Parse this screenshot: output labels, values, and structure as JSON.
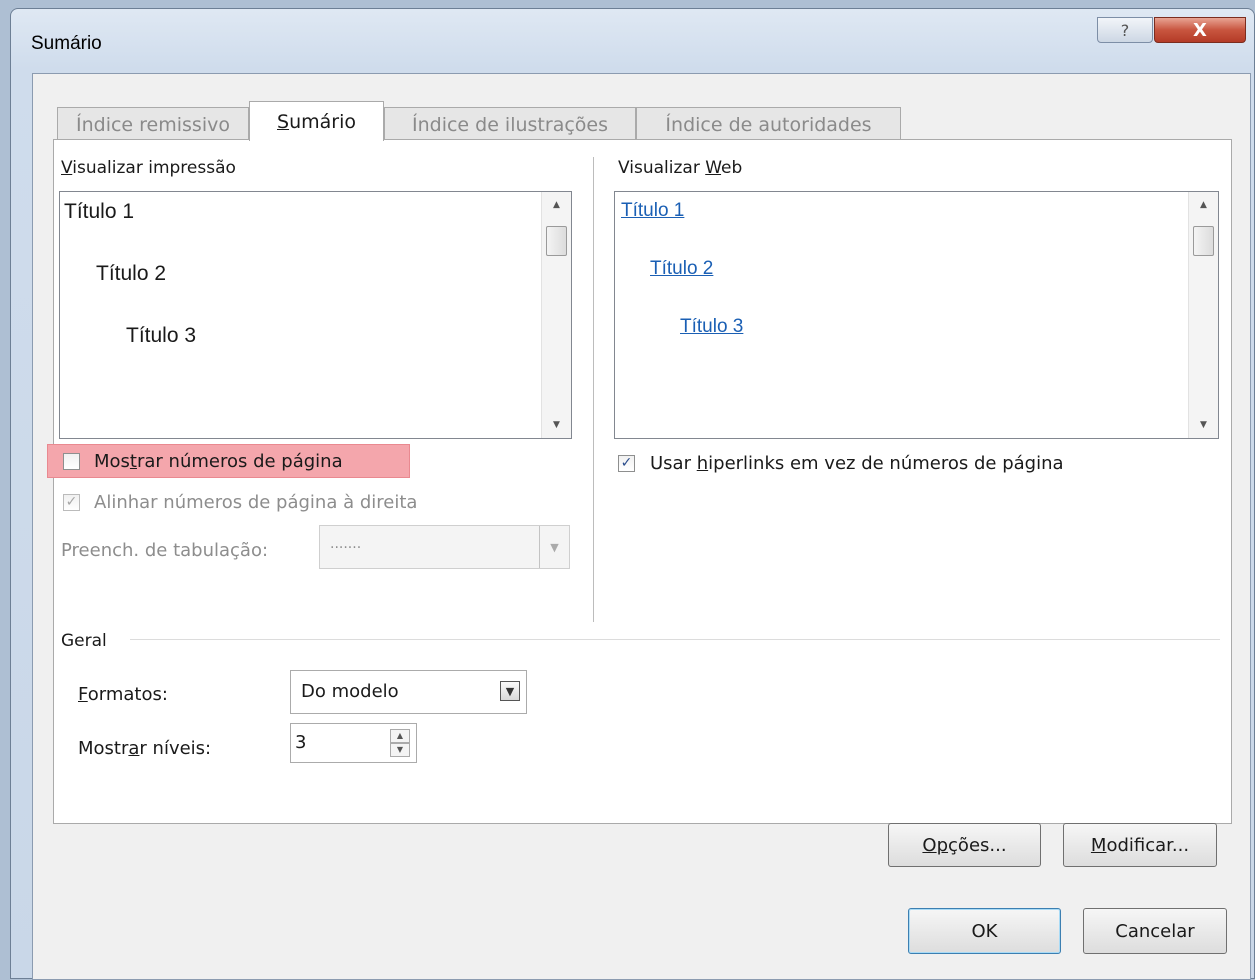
{
  "window": {
    "title": "Sumário",
    "help_glyph": "?",
    "close_glyph": "X"
  },
  "tabs": [
    {
      "label": "Índice remissivo",
      "active": false
    },
    {
      "label": "Sumário",
      "active": true
    },
    {
      "label": "Índice de ilustrações",
      "active": false
    },
    {
      "label": "Índice de autoridades",
      "active": false
    }
  ],
  "print_preview": {
    "label": "Visualizar impressão",
    "items": [
      "Título 1",
      "Título 2",
      "Título 3"
    ]
  },
  "web_preview": {
    "label_prefix": "Visualizar ",
    "label_accel": "W",
    "label_suffix": "eb",
    "items": [
      "Título 1",
      "Título 2",
      "Título 3"
    ]
  },
  "options": {
    "show_page_numbers": {
      "label_pre": "Mos",
      "label_accel": "t",
      "label_post": "rar números de página",
      "checked": false
    },
    "align_right": {
      "label": "Alinhar números de página à direita",
      "checked": true,
      "disabled": true
    },
    "tab_leader": {
      "label": "Preench. de tabulação:",
      "value": ".......",
      "disabled": true
    },
    "use_hyperlinks": {
      "label_pre": "Usar ",
      "label_accel": "h",
      "label_post": "iperlinks em vez de números de página",
      "checked": true
    }
  },
  "general": {
    "label": "Geral",
    "formats": {
      "label_accel": "F",
      "label_rest": "ormatos:",
      "value": "Do modelo"
    },
    "levels": {
      "label_pre": "Mostr",
      "label_accel": "a",
      "label_post": "r níveis:",
      "value": "3"
    }
  },
  "buttons": {
    "options": {
      "pre": "O",
      "accel": "p",
      "post": "ções..."
    },
    "modify": {
      "accel": "M",
      "post": "odificar..."
    },
    "ok": "OK",
    "cancel": "Cancelar"
  },
  "colors": {
    "accent_link": "#1a5fb4",
    "highlight": "#f4a6ac",
    "close_button": "#c8553f"
  }
}
